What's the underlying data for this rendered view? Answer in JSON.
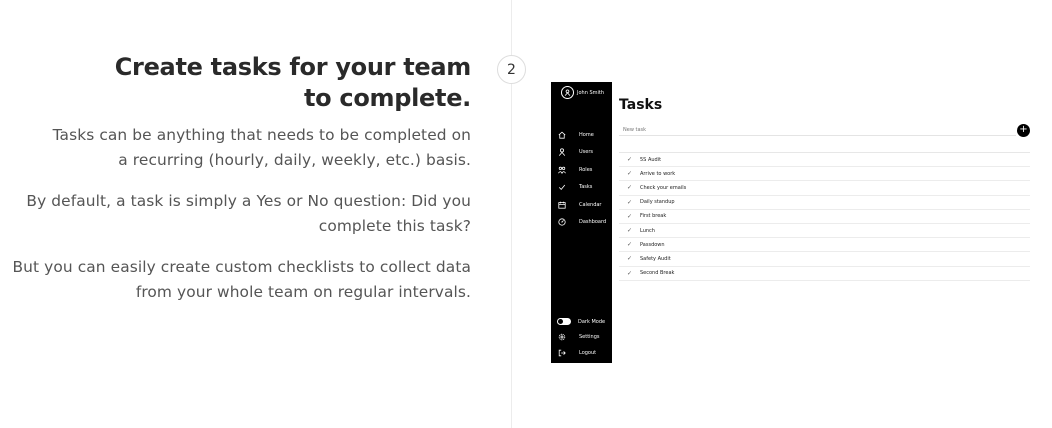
{
  "section": {
    "step_number": "2",
    "title": "Create tasks for your team to complete.",
    "paragraphs": [
      "Tasks can be anything that needs to be completed on a recurring (hourly, daily, weekly, etc.) basis.",
      "By default, a task is simply a Yes or No question: Did you complete this task?",
      "But you can easily create custom checklists to collect data from your whole team on regular intervals."
    ]
  },
  "app": {
    "user": {
      "name": "John Smith",
      "avatar_icon": "user-icon"
    },
    "nav": [
      {
        "label": "Home",
        "icon": "home-icon"
      },
      {
        "label": "Users",
        "icon": "user-icon"
      },
      {
        "label": "Roles",
        "icon": "roles-icon"
      },
      {
        "label": "Tasks",
        "icon": "check-icon"
      },
      {
        "label": "Calendar",
        "icon": "calendar-icon"
      },
      {
        "label": "Dashboard",
        "icon": "dashboard-icon"
      }
    ],
    "bottom": {
      "dark_mode_label": "Dark Mode",
      "settings_label": "Settings",
      "logout_label": "Logout"
    },
    "main": {
      "title": "Tasks",
      "new_task_placeholder": "New task",
      "add_label": "+",
      "tasks": [
        "5S Audit",
        "Arrive to work",
        "Check your emails",
        "Daily standup",
        "First break",
        "Lunch",
        "Passdown",
        "Safety Audit",
        "Second Break"
      ]
    }
  }
}
